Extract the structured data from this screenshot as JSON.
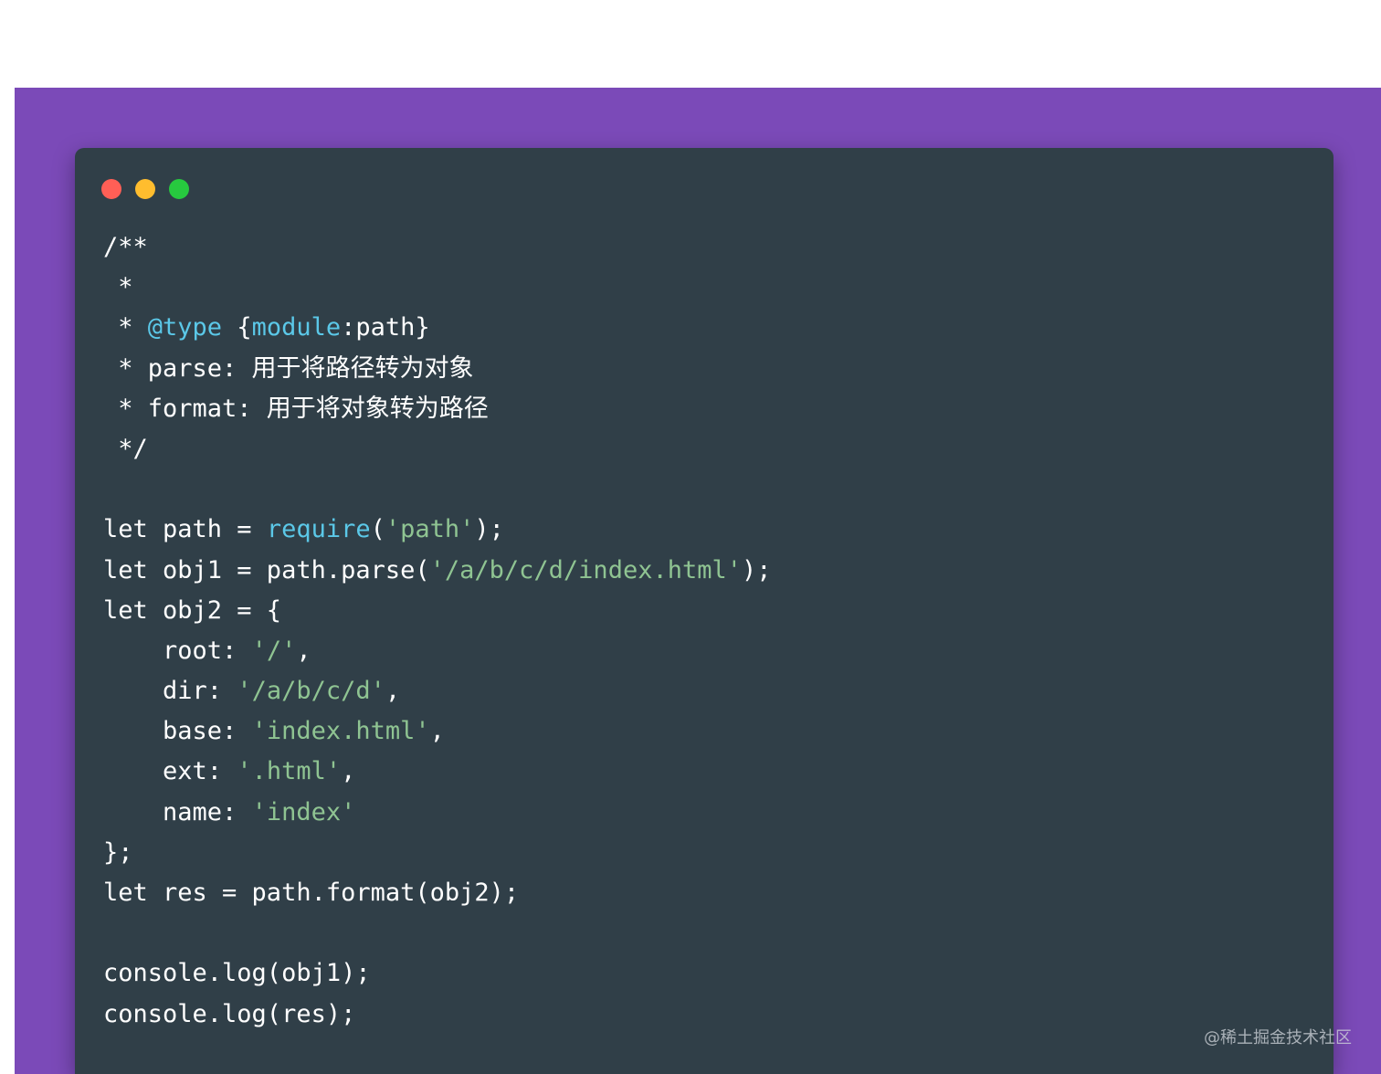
{
  "window": {
    "controls": [
      {
        "name": "close",
        "color": "#ff5f56"
      },
      {
        "name": "minimize",
        "color": "#ffbd2e"
      },
      {
        "name": "maximize",
        "color": "#27c93f"
      }
    ]
  },
  "code_lines": [
    [
      {
        "t": "/**",
        "c": "plain"
      }
    ],
    [
      {
        "t": " *",
        "c": "plain"
      }
    ],
    [
      {
        "t": " * ",
        "c": "plain"
      },
      {
        "t": "@type",
        "c": "kw"
      },
      {
        "t": " {",
        "c": "plain"
      },
      {
        "t": "module",
        "c": "kw"
      },
      {
        "t": ":path}",
        "c": "plain"
      }
    ],
    [
      {
        "t": " * parse: 用于将路径转为对象",
        "c": "plain"
      }
    ],
    [
      {
        "t": " * format: 用于将对象转为路径",
        "c": "plain"
      }
    ],
    [
      {
        "t": " */",
        "c": "plain"
      }
    ],
    [],
    [
      {
        "t": "let path = ",
        "c": "plain"
      },
      {
        "t": "require",
        "c": "kw"
      },
      {
        "t": "(",
        "c": "plain"
      },
      {
        "t": "'path'",
        "c": "str"
      },
      {
        "t": ");",
        "c": "plain"
      }
    ],
    [
      {
        "t": "let obj1 = path.parse(",
        "c": "plain"
      },
      {
        "t": "'/a/b/c/d/index.html'",
        "c": "str"
      },
      {
        "t": ");",
        "c": "plain"
      }
    ],
    [
      {
        "t": "let obj2 = {",
        "c": "plain"
      }
    ],
    [
      {
        "t": "    root: ",
        "c": "plain"
      },
      {
        "t": "'/'",
        "c": "str"
      },
      {
        "t": ",",
        "c": "plain"
      }
    ],
    [
      {
        "t": "    dir: ",
        "c": "plain"
      },
      {
        "t": "'/a/b/c/d'",
        "c": "str"
      },
      {
        "t": ",",
        "c": "plain"
      }
    ],
    [
      {
        "t": "    base: ",
        "c": "plain"
      },
      {
        "t": "'index.html'",
        "c": "str"
      },
      {
        "t": ",",
        "c": "plain"
      }
    ],
    [
      {
        "t": "    ext: ",
        "c": "plain"
      },
      {
        "t": "'.html'",
        "c": "str"
      },
      {
        "t": ",",
        "c": "plain"
      }
    ],
    [
      {
        "t": "    name: ",
        "c": "plain"
      },
      {
        "t": "'index'",
        "c": "str"
      }
    ],
    [
      {
        "t": "};",
        "c": "plain"
      }
    ],
    [
      {
        "t": "let res = path.format(obj2);",
        "c": "plain"
      }
    ],
    [],
    [
      {
        "t": "console.log(obj1);",
        "c": "plain"
      }
    ],
    [
      {
        "t": "console.log(res);",
        "c": "plain"
      }
    ]
  ],
  "watermark": "@稀土掘金技术社区"
}
